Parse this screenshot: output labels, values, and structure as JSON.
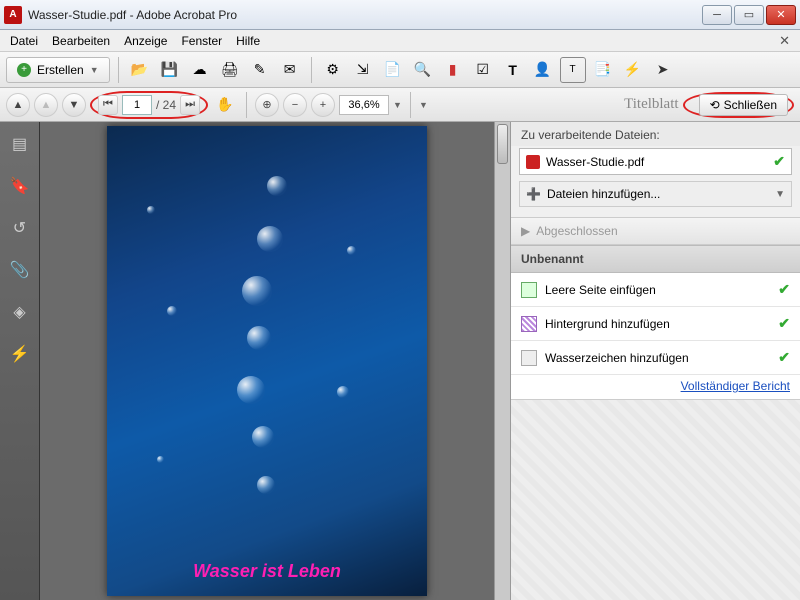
{
  "window": {
    "title": "Wasser-Studie.pdf - Adobe Acrobat Pro"
  },
  "menu": {
    "items": [
      "Datei",
      "Bearbeiten",
      "Anzeige",
      "Fenster",
      "Hilfe"
    ]
  },
  "toolbar": {
    "create_label": "Erstellen"
  },
  "pagenav": {
    "current_page": "1",
    "total_pages_label": "/ 24",
    "zoom_value": "36,6%",
    "titelblatt_label": "Titelblatt",
    "close_label": "Schließen"
  },
  "document": {
    "caption": "Wasser ist Leben"
  },
  "panel": {
    "files_label": "Zu verarbeitende Dateien:",
    "file_name": "Wasser-Studie.pdf",
    "add_files_label": "Dateien hinzufügen...",
    "status_label": "Abgeschlossen",
    "section_title": "Unbenannt",
    "actions": [
      {
        "label": "Leere Seite einfügen"
      },
      {
        "label": "Hintergrund hinzufügen"
      },
      {
        "label": "Wasserzeichen hinzufügen"
      }
    ],
    "report_link": "Vollständiger Bericht"
  }
}
